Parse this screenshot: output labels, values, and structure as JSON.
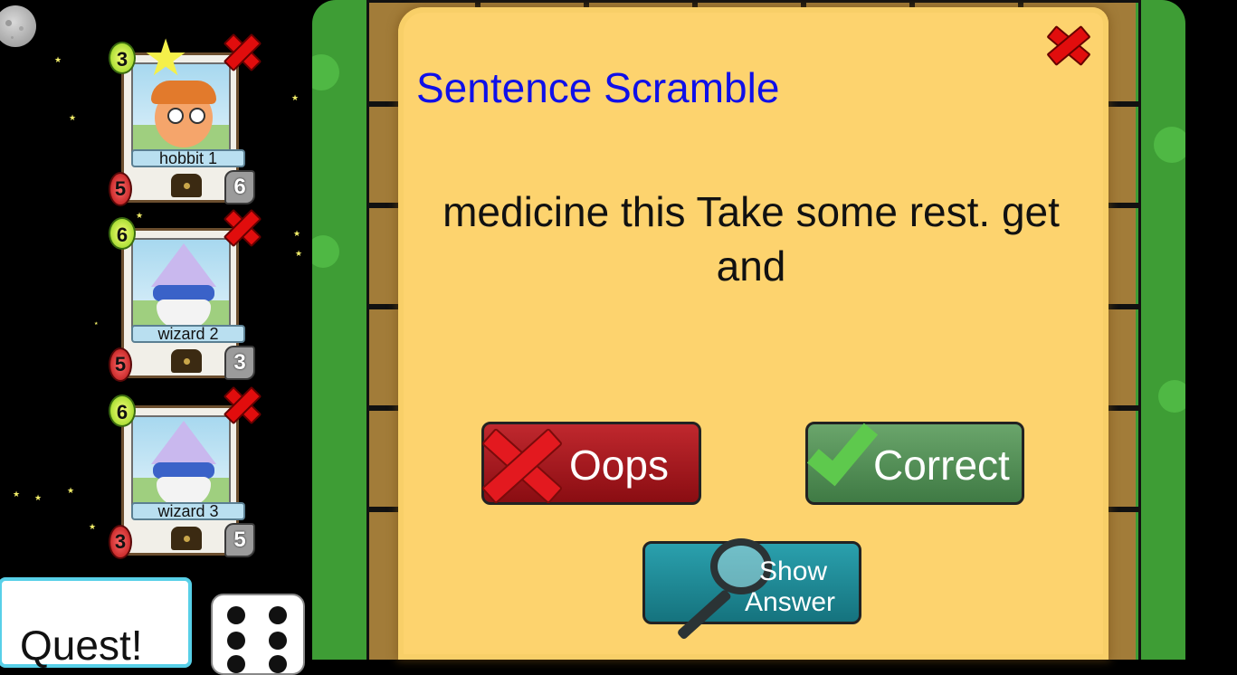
{
  "players": [
    {
      "name": "hobbit 1",
      "level": "3",
      "health": "5",
      "attack": "6",
      "avatar": "hobbit-avatar"
    },
    {
      "name": "wizard 2",
      "level": "6",
      "health": "5",
      "attack": "3",
      "avatar": "wizard-avatar"
    },
    {
      "name": "wizard 3",
      "level": "6",
      "health": "3",
      "attack": "5",
      "avatar": "wizard-avatar"
    }
  ],
  "quest_button": {
    "label": "Quest!"
  },
  "dice": {
    "value": 6
  },
  "dialog": {
    "title": "Sentence Scramble",
    "sentence": "medicine this Take some rest. get and",
    "oops_label": "Oops",
    "correct_label": "Correct",
    "show_answer_line1": "Show",
    "show_answer_line2": "Answer"
  },
  "colors": {
    "title": "#1010e8",
    "dialog_bg": "#fdd36e",
    "oops": "#a8141b",
    "correct": "#5a9560",
    "show_answer": "#1f8b96"
  }
}
